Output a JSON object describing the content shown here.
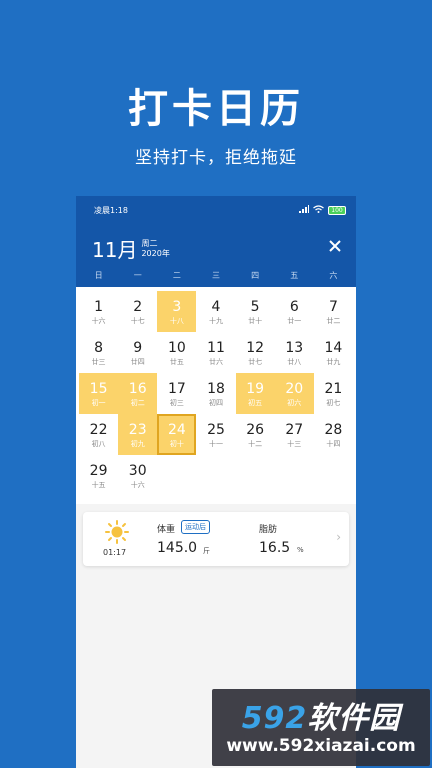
{
  "promo": {
    "title": "打卡日历",
    "subtitle": "坚持打卡，拒绝拖延"
  },
  "status_bar": {
    "time": "凌晨1:18",
    "battery": "100"
  },
  "header": {
    "month": "11月",
    "weekday": "周二",
    "year": "2020年",
    "close_icon": "close-icon"
  },
  "weekdays": [
    "日",
    "一",
    "二",
    "三",
    "四",
    "五",
    "六"
  ],
  "calendar": {
    "rows": [
      [
        {
          "day": "1",
          "lunar": "十六"
        },
        {
          "day": "2",
          "lunar": "十七"
        },
        {
          "day": "3",
          "lunar": "十八",
          "checked": true
        },
        {
          "day": "4",
          "lunar": "十九"
        },
        {
          "day": "5",
          "lunar": "廿十"
        },
        {
          "day": "6",
          "lunar": "廿一"
        },
        {
          "day": "7",
          "lunar": "廿二"
        }
      ],
      [
        {
          "day": "8",
          "lunar": "廿三"
        },
        {
          "day": "9",
          "lunar": "廿四"
        },
        {
          "day": "10",
          "lunar": "廿五"
        },
        {
          "day": "11",
          "lunar": "廿六"
        },
        {
          "day": "12",
          "lunar": "廿七"
        },
        {
          "day": "13",
          "lunar": "廿八"
        },
        {
          "day": "14",
          "lunar": "廿九"
        }
      ],
      [
        {
          "day": "15",
          "lunar": "初一",
          "checked": true
        },
        {
          "day": "16",
          "lunar": "初二",
          "checked": true
        },
        {
          "day": "17",
          "lunar": "初三"
        },
        {
          "day": "18",
          "lunar": "初四"
        },
        {
          "day": "19",
          "lunar": "初五",
          "checked": true
        },
        {
          "day": "20",
          "lunar": "初六",
          "checked": true
        },
        {
          "day": "21",
          "lunar": "初七"
        }
      ],
      [
        {
          "day": "22",
          "lunar": "初八"
        },
        {
          "day": "23",
          "lunar": "初九",
          "checked": true
        },
        {
          "day": "24",
          "lunar": "初十",
          "checked": true,
          "selected": true
        },
        {
          "day": "25",
          "lunar": "十一"
        },
        {
          "day": "26",
          "lunar": "十二"
        },
        {
          "day": "27",
          "lunar": "十三"
        },
        {
          "day": "28",
          "lunar": "十四"
        }
      ],
      [
        {
          "day": "29",
          "lunar": "十五"
        },
        {
          "day": "30",
          "lunar": "十六"
        },
        null,
        null,
        null,
        null,
        null
      ]
    ]
  },
  "record": {
    "icon": "sun-icon",
    "time": "01:17",
    "weight_label": "体重",
    "tag": "运动后",
    "weight_value": "145.0",
    "weight_unit": "斤",
    "fat_label": "脂肪",
    "fat_value": "16.5",
    "fat_unit": "%",
    "chevron": "›"
  },
  "watermark": {
    "brand_num": "592",
    "brand_cn": "软件园",
    "url": "www.592xiazai.com"
  },
  "colors": {
    "background": "#1f6fc3",
    "header": "#1456a8",
    "checked": "#fbd36a",
    "selected_border": "#e0a520"
  }
}
